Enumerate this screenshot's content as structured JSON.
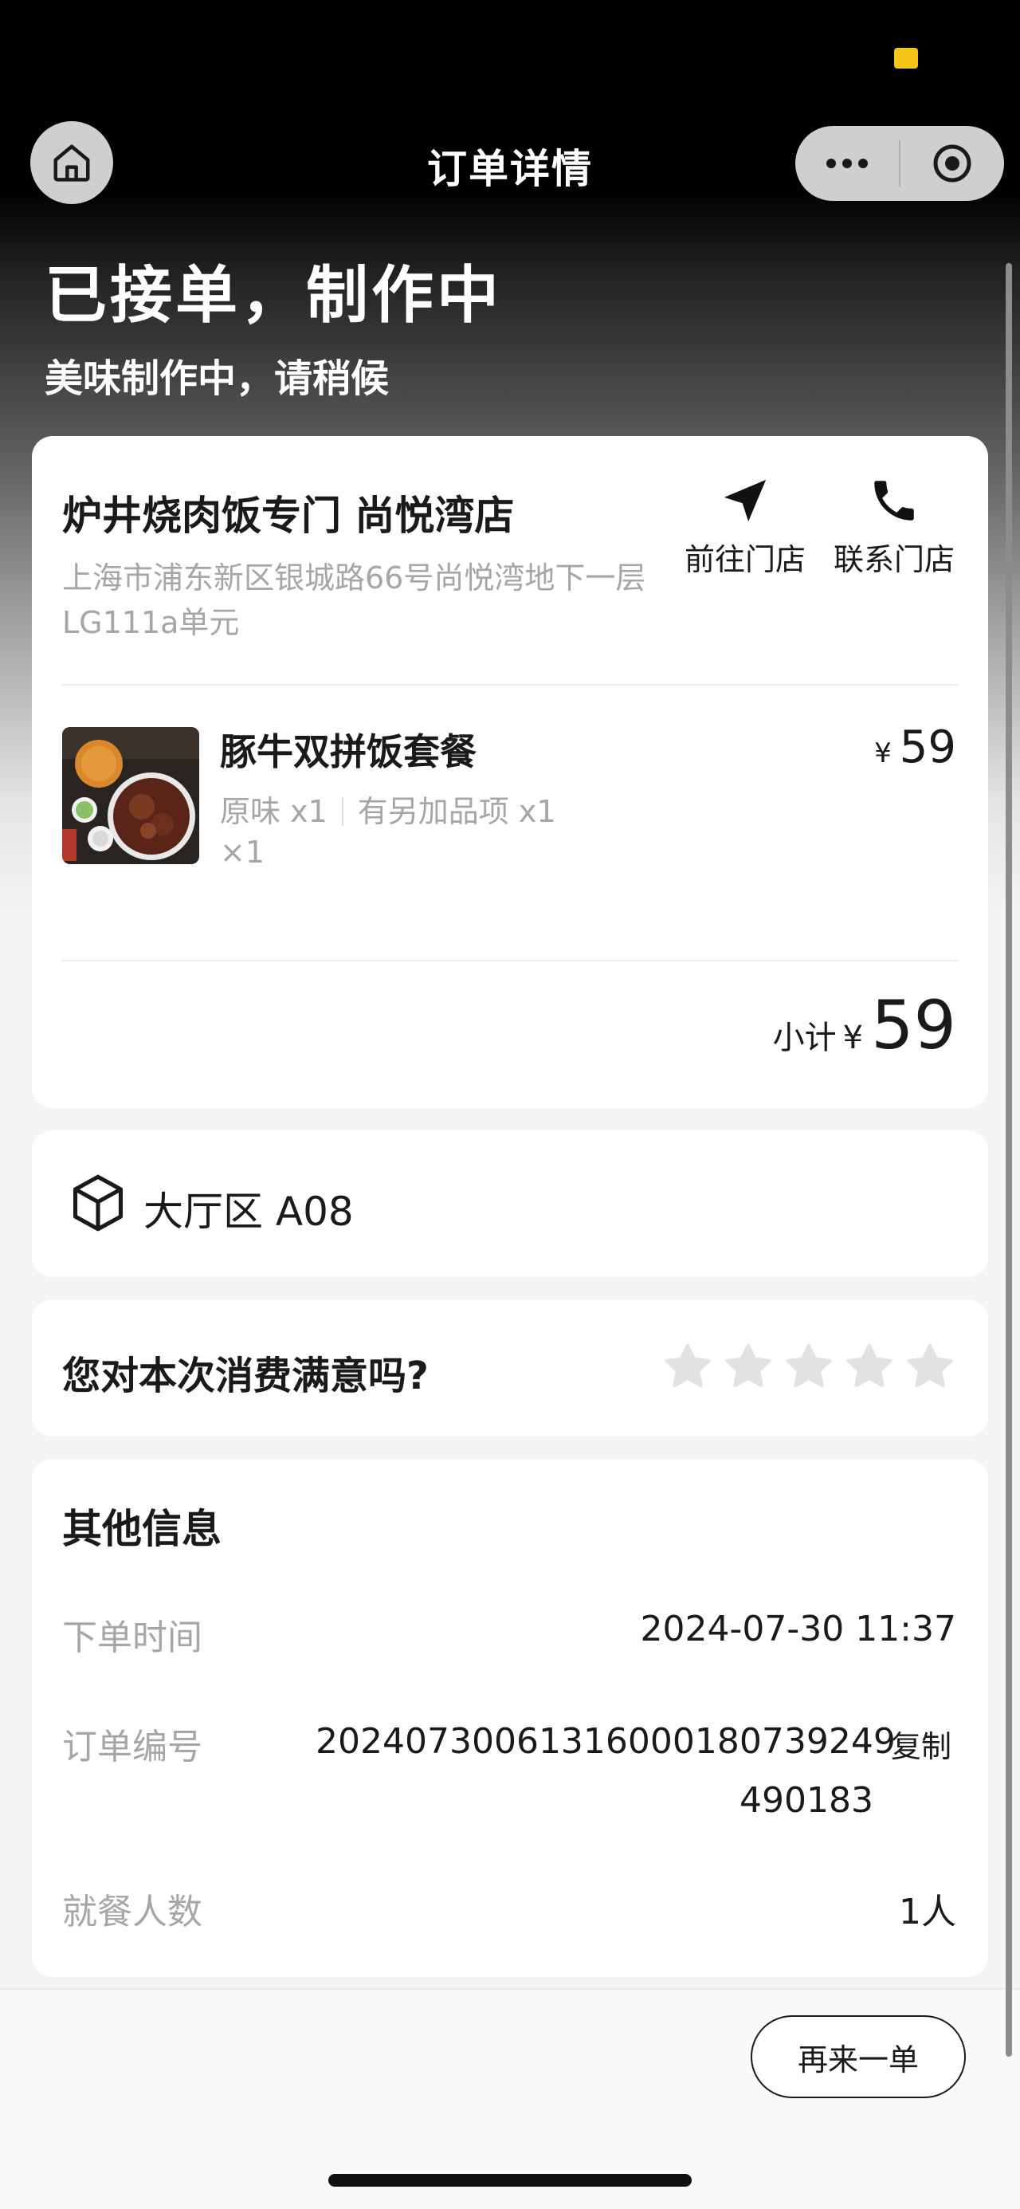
{
  "nav": {
    "title": "订单详情"
  },
  "status": {
    "title": "已接单，制作中",
    "subtitle": "美味制作中，请稍候"
  },
  "store": {
    "name": "炉井烧肉饭专门 尚悦湾店",
    "address": "上海市浦东新区银城路66号尚悦湾地下一层LG111a单元",
    "actions": {
      "navigate_label": "前往门店",
      "call_label": "联系门店"
    }
  },
  "item": {
    "name": "豚牛双拼饭套餐",
    "option1": "原味 x1",
    "option2": "有另加品项 x1",
    "quantity": "×1",
    "currency": "¥",
    "price": "59"
  },
  "subtotal": {
    "label": "小计",
    "currency": "¥",
    "amount": "59"
  },
  "table": {
    "label": "大厅区 A08"
  },
  "rating": {
    "question": "您对本次消费满意吗?",
    "max_stars": 5,
    "selected_stars": 0
  },
  "info": {
    "title": "其他信息",
    "order_time_label": "下单时间",
    "order_time": "2024-07-30 11:37",
    "order_no_label": "订单编号",
    "order_no_line1": "20240730061316000180739249",
    "order_no_line2": "490183",
    "copy_label": "复制",
    "diners_label": "就餐人数",
    "diners": "1人"
  },
  "footer": {
    "reorder_label": "再来一单"
  },
  "colors": {
    "accent_yellow": "#f5c518",
    "text_primary": "#1a1a1a",
    "text_secondary": "#a6a6a6"
  },
  "icons": [
    "home-icon",
    "more-icon",
    "target-icon",
    "navigate-arrow-icon",
    "phone-icon",
    "table-box-icon",
    "star-icon"
  ]
}
